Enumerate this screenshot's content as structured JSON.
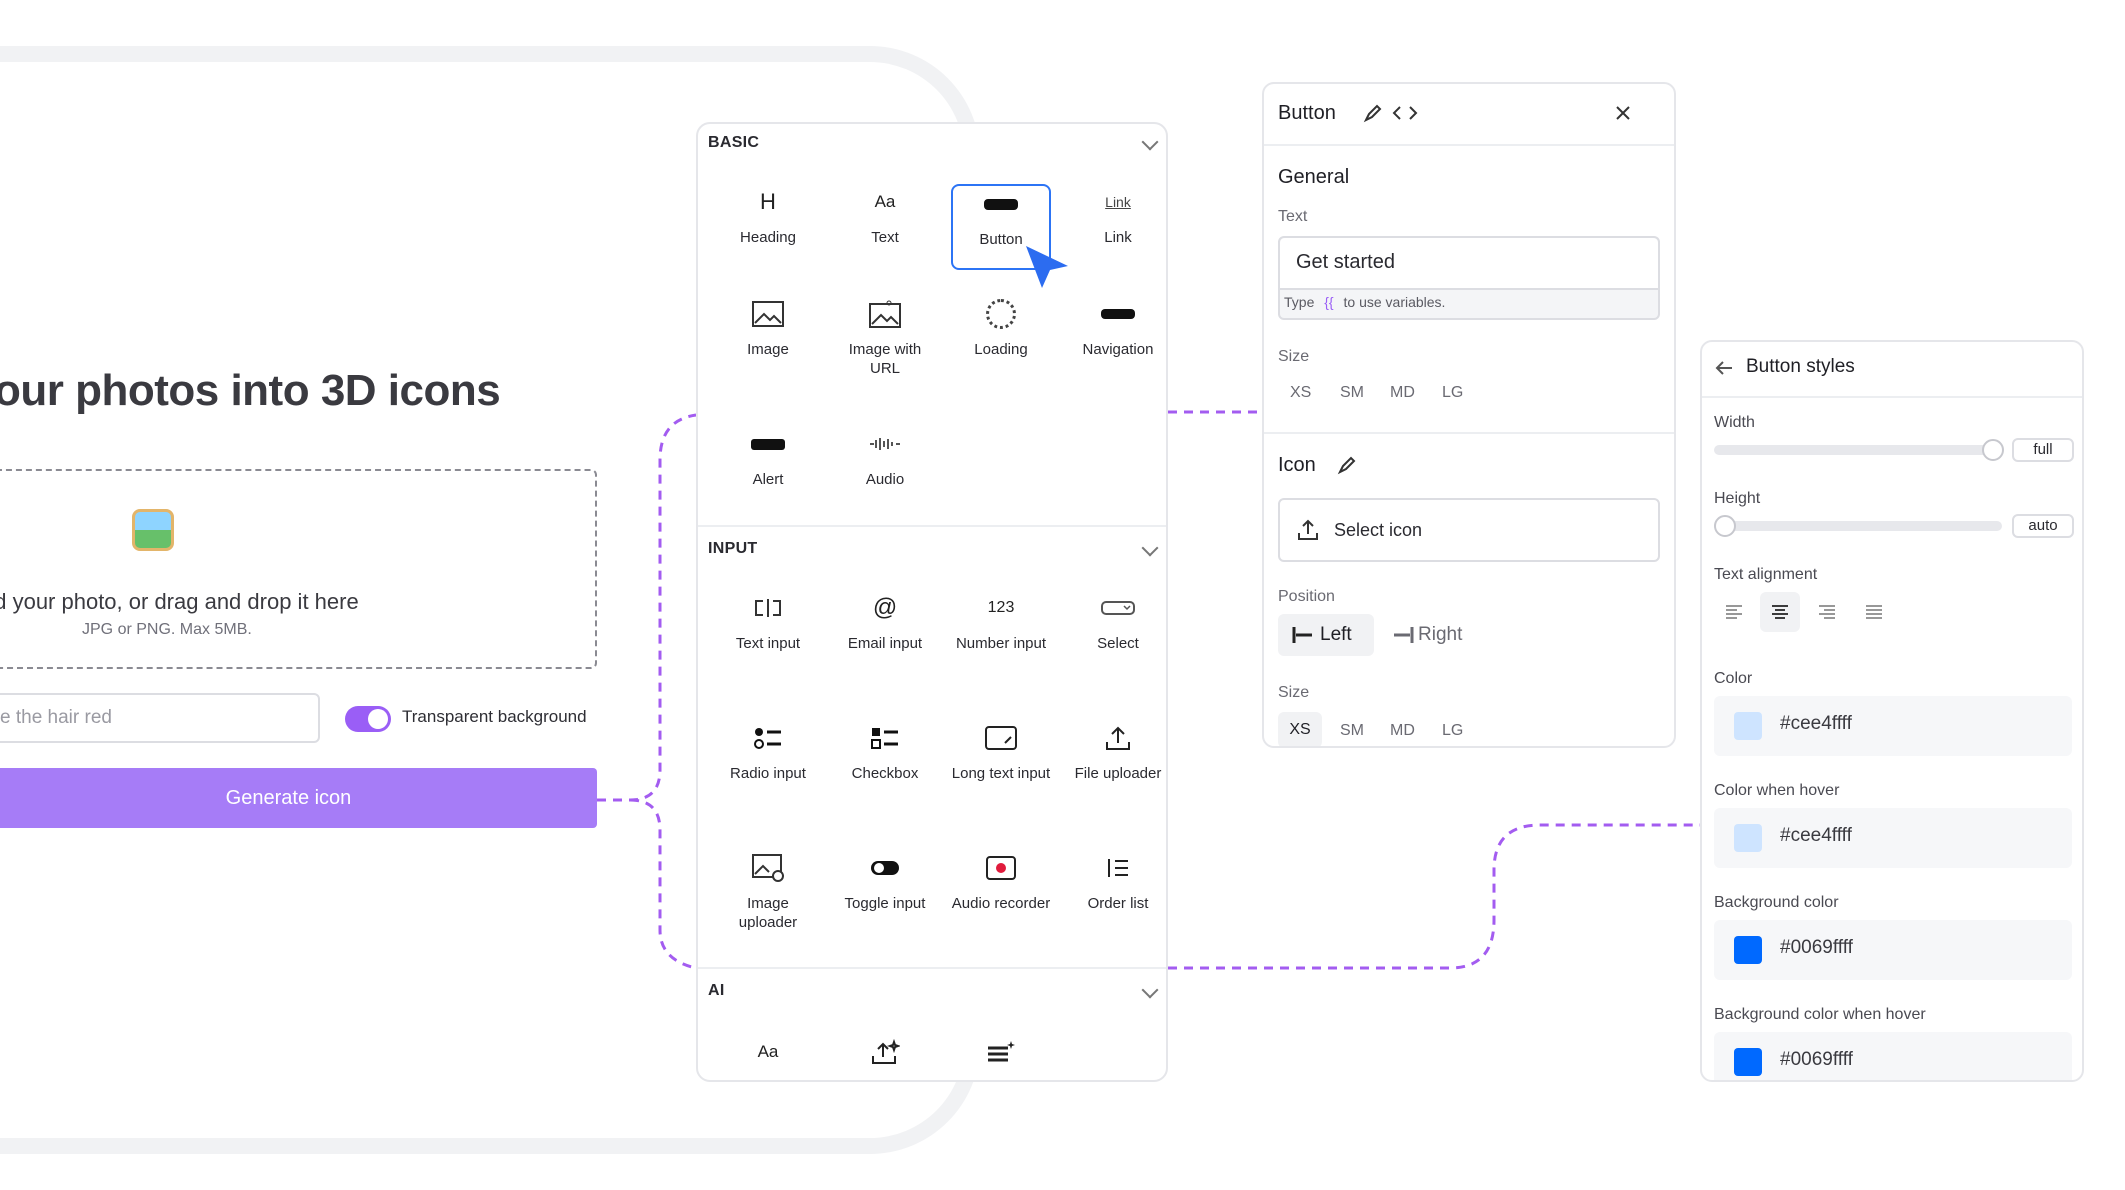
{
  "app": {
    "hero_title": "our photos into 3D icons",
    "upload_text": "ad your photo, or drag and drop it here",
    "upload_sub": "JPG or PNG. Max 5MB.",
    "prompt_value": "e the hair red",
    "toggle_label": "Transparent background",
    "generate_label": "Generate icon"
  },
  "components": {
    "sections": {
      "basic": "BASIC",
      "input": "INPUT",
      "ai": "AI"
    },
    "basic": [
      "Heading",
      "Text",
      "Button",
      "Link",
      "Image",
      "Image with URL",
      "Loading",
      "Navigation",
      "Alert",
      "Audio"
    ],
    "input": [
      "Text input",
      "Email input",
      "Number input",
      "Select",
      "Radio input",
      "Checkbox",
      "Long text input",
      "File uploader",
      "Image uploader",
      "Toggle input",
      "Audio recorder",
      "Order list"
    ],
    "icon_text": {
      "heading": "H",
      "text": "Aa",
      "link": "Link",
      "number": "123",
      "email": "@",
      "ai_text": "Aa"
    },
    "accent_color": "#2c74f5"
  },
  "properties": {
    "title": "Button",
    "general": "General",
    "text_label": "Text",
    "text_value": "Get started",
    "hint_prefix": "Type",
    "hint_braces": "{{",
    "hint_suffix": "to use variables.",
    "size_label": "Size",
    "sizes": [
      "XS",
      "SM",
      "MD",
      "LG"
    ],
    "icon_label": "Icon",
    "select_icon": "Select icon",
    "position_label": "Position",
    "position_left": "Left",
    "position_right": "Right",
    "size_label_2": "Size"
  },
  "styles": {
    "title": "Button styles",
    "width_label": "Width",
    "width_value": "full",
    "width_level": 1.0,
    "height_label": "Height",
    "height_value": "auto",
    "height_level": 0.0,
    "alignment_label": "Text alignment",
    "colors": [
      {
        "label": "Color",
        "value": "#cee4ffff",
        "swatch": "#cee4ff"
      },
      {
        "label": "Color when hover",
        "value": "#cee4ffff",
        "swatch": "#cee4ff"
      },
      {
        "label": "Background color",
        "value": "#0069ffff",
        "swatch": "#0069ff"
      },
      {
        "label": "Background color when hover",
        "value": "#0069ffff",
        "swatch": "#0069ff"
      }
    ]
  }
}
